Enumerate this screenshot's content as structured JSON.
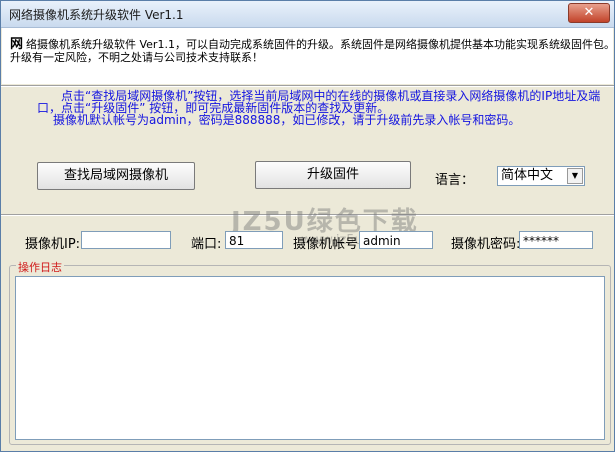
{
  "window": {
    "title": "网络摄像机系统升级软件 Ver1.1",
    "close_glyph": "✕"
  },
  "header": {
    "icon_text": "网",
    "line1": "络摄像机系统升级软件 Ver1.1，可以自动完成系统固件的升级。系统固件是网络摄像机提供基本功能实现系统级固件包。",
    "line2": "升级有一定风险，不明之处请与公司技术支持联系！"
  },
  "info": {
    "line1": "点击“查找局域网摄像机”按钮，选择当前局域网中的在线的摄像机或直接录入网络摄像机的IP地址及端",
    "line2": "口，点击“升级固件” 按钮，即可完成最新固件版本的查找及更新。",
    "line3": "摄像机默认帐号为admin，密码是888888，如已修改，请于升级前先录入帐号和密码。"
  },
  "buttons": {
    "find": "查找局域网摄像机",
    "upgrade": "升级固件"
  },
  "language": {
    "label": "语言：",
    "selected": "简体中文"
  },
  "fields": {
    "ip_label": "摄像机IP:",
    "ip_value": "",
    "port_label": "端口:",
    "port_value": "81",
    "account_label": "摄像机帐号:",
    "account_value": "admin",
    "password_label": "摄像机密码:",
    "password_value": "******"
  },
  "log": {
    "legend": "操作日志"
  },
  "watermark": {
    "main": "JZ5U绿色下载",
    "sub": "www.jz5u.com"
  }
}
